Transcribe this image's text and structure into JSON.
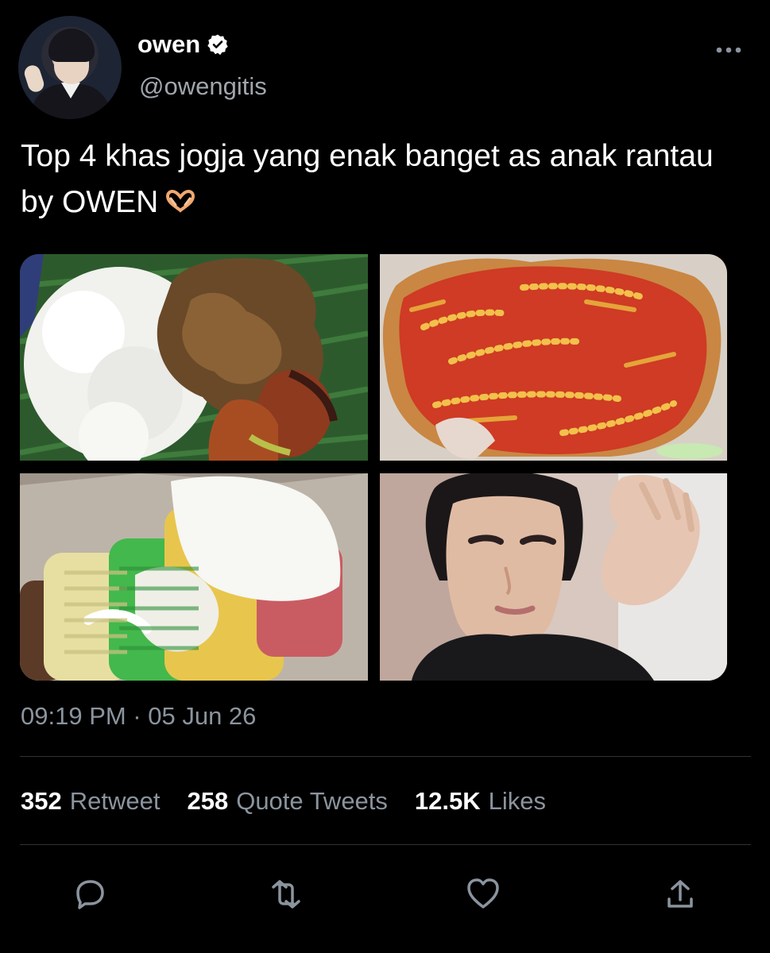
{
  "author": {
    "display_name": "owen",
    "handle": "@owengitis",
    "verified_badge": "verified-check-icon",
    "avatar": "profile-photo"
  },
  "tweet": {
    "text": "Top 4 khas jogja yang enak banget as anak rantau by OWEN",
    "emoji": "heart-hands",
    "timestamp": "09:19 PM · 05 Jun 26"
  },
  "media": [
    {
      "alt": "nasi gudeg on banana leaf"
    },
    {
      "alt": "ayam geprek with sambal"
    },
    {
      "alt": "colorful traditional kue with grated coconut"
    },
    {
      "alt": "selfie of a man"
    }
  ],
  "stats": {
    "retweets": {
      "count": "352",
      "label": "Retweet"
    },
    "quotes": {
      "count": "258",
      "label": "Quote Tweets"
    },
    "likes": {
      "count": "12.5K",
      "label": "Likes"
    }
  },
  "actions": [
    {
      "name": "reply",
      "icon": "reply-icon"
    },
    {
      "name": "retweet",
      "icon": "retweet-icon"
    },
    {
      "name": "like",
      "icon": "heart-icon"
    },
    {
      "name": "share",
      "icon": "share-icon"
    }
  ],
  "colors": {
    "background": "#000000",
    "text": "#ffffff",
    "muted": "#8b949e",
    "divider": "#2f3336"
  }
}
